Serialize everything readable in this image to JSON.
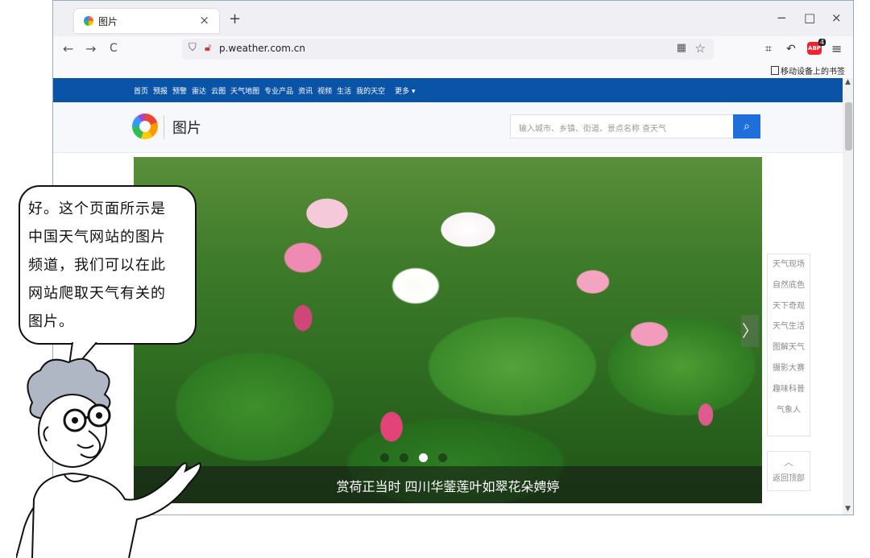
{
  "browser": {
    "tab_title": "图片",
    "tab_close": "×",
    "new_tab": "+",
    "win_min": "−",
    "win_max": "□",
    "win_close": "×",
    "back": "←",
    "forward": "→",
    "reload": "C",
    "url": "p.weather.com.cn",
    "abp_label": "ABP",
    "abp_badge": "4",
    "menu": "≡",
    "bookmark": "移动设备上的书签"
  },
  "site": {
    "nav": [
      "首页",
      "预报",
      "预警",
      "雷达",
      "云图",
      "天气地图",
      "专业产品",
      "资讯",
      "视频",
      "生活",
      "我的天空"
    ],
    "nav_more": "更多 ▾",
    "channel": "图片",
    "search_placeholder": "输入城市、乡镇、街道、景点名称 查天气"
  },
  "hero": {
    "caption": "赏荷正当时 四川华蓥莲叶如翠花朵娉婷",
    "next_arrow": "〉"
  },
  "side_menu": [
    "天气现场",
    "自然底色",
    "天下奇观",
    "天气生活",
    "图解天气",
    "摄影大赛",
    "趣味科普",
    "气象人"
  ],
  "back_to_top": "返回顶部",
  "comic": {
    "lines": [
      "好。这个页面所示是",
      "中国天气网站的图片",
      "频道，我们可以在此",
      "网站爬取天气有关的",
      "图片。"
    ]
  }
}
